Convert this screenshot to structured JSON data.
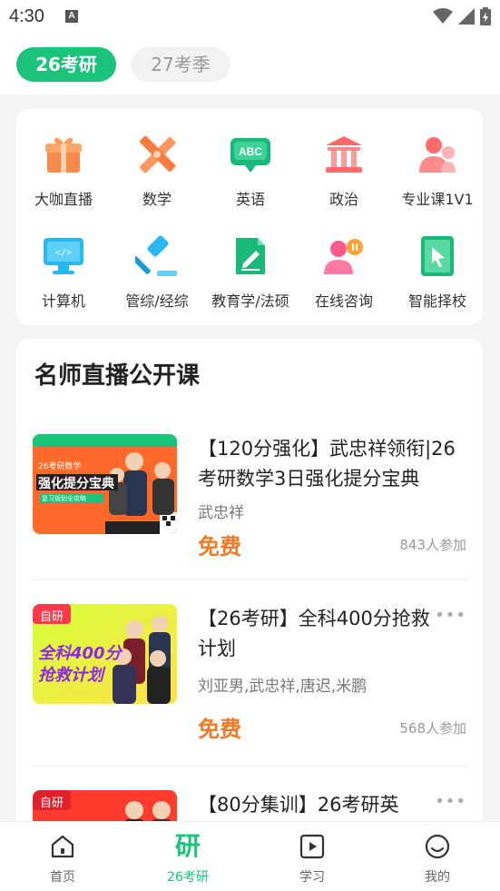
{
  "status": {
    "time": "4:30"
  },
  "tabs": {
    "active": "26考研",
    "inactive": "27考季"
  },
  "categories": [
    {
      "label": "大咖直播",
      "icon": "gift-box-icon"
    },
    {
      "label": "数学",
      "icon": "ruler-pencil-icon"
    },
    {
      "label": "英语",
      "icon": "abc-chat-icon"
    },
    {
      "label": "政治",
      "icon": "government-building-icon"
    },
    {
      "label": "专业课1V1",
      "icon": "tutor-person-icon"
    },
    {
      "label": "计算机",
      "icon": "computer-monitor-icon"
    },
    {
      "label": "管综/经综",
      "icon": "gavel-icon"
    },
    {
      "label": "教育学/法硕",
      "icon": "edit-document-icon"
    },
    {
      "label": "在线咨询",
      "icon": "consult-person-icon"
    },
    {
      "label": "智能择校",
      "icon": "cursor-select-icon"
    }
  ],
  "section_title": "名师直播公开课",
  "courses": [
    {
      "title": "【120分强化】武忠祥领衔|26考研数学3日强化提分宝典",
      "teacher": "武忠祥",
      "price": "免费",
      "count": "843人参加",
      "thumb": {
        "tag": "26考研数学",
        "headline": "强化提分宝典",
        "sub": "复习规划全攻略"
      }
    },
    {
      "title": "【26考研】全科400分抢救计划",
      "teacher": "刘亚男,武忠祥,唐迟,米鹏",
      "price": "免费",
      "count": "568人参加",
      "thumb": {
        "badge": "自研",
        "headline1": "全科400分",
        "headline2": "抢救计划"
      }
    },
    {
      "title": "【80分集训】26考研英",
      "thumb": {
        "badge": "自研"
      }
    }
  ],
  "nav": [
    {
      "label": "首页",
      "icon": "home-icon"
    },
    {
      "label": "26考研",
      "icon": "yan-icon",
      "glyph": "研"
    },
    {
      "label": "学习",
      "icon": "play-square-icon"
    },
    {
      "label": "我的",
      "icon": "smile-face-icon"
    }
  ],
  "colors": {
    "brand": "#1bc37a",
    "price": "#f27a26"
  }
}
